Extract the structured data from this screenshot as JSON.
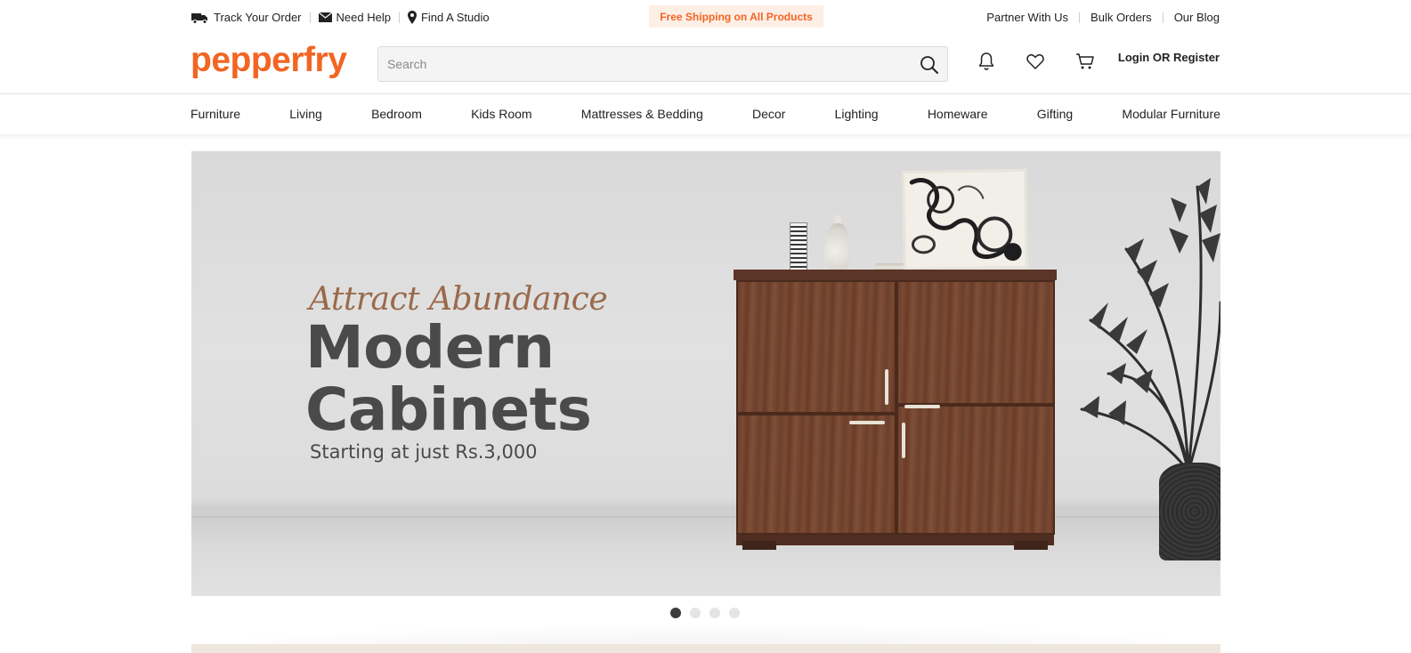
{
  "util_bar": {
    "left_links": [
      {
        "label": "Track Your Order",
        "icon": "truck-icon"
      },
      {
        "label": "Need Help",
        "icon": "mail-icon"
      },
      {
        "label": "Find A Studio",
        "icon": "map-pin-icon"
      }
    ],
    "promo": "Free Shipping on All Products",
    "right_links": [
      "Partner With Us",
      "Bulk Orders",
      "Our Blog"
    ]
  },
  "header": {
    "logo": "pepperfry",
    "search_placeholder": "Search",
    "search_value": "",
    "icons": [
      "bell-icon",
      "heart-icon",
      "cart-icon"
    ],
    "login_label": "Login OR Register"
  },
  "categories": [
    "Furniture",
    "Living",
    "Bedroom",
    "Kids Room",
    "Mattresses & Bedding",
    "Decor",
    "Lighting",
    "Homeware",
    "Gifting",
    "Modular Furniture"
  ],
  "hero": {
    "kicker": "Attract Abundance",
    "title_line1": "Modern",
    "title_line2": "Cabinets",
    "subtitle": "Starting at just Rs.3,000",
    "slide_index": 1,
    "slide_count": 4
  },
  "colors": {
    "brand": "#f26522",
    "promo_bg": "#fdeee6",
    "kicker": "#9a6a4b",
    "dot_active": "#3b3b3b",
    "dot_inactive": "#e4e4e4"
  }
}
